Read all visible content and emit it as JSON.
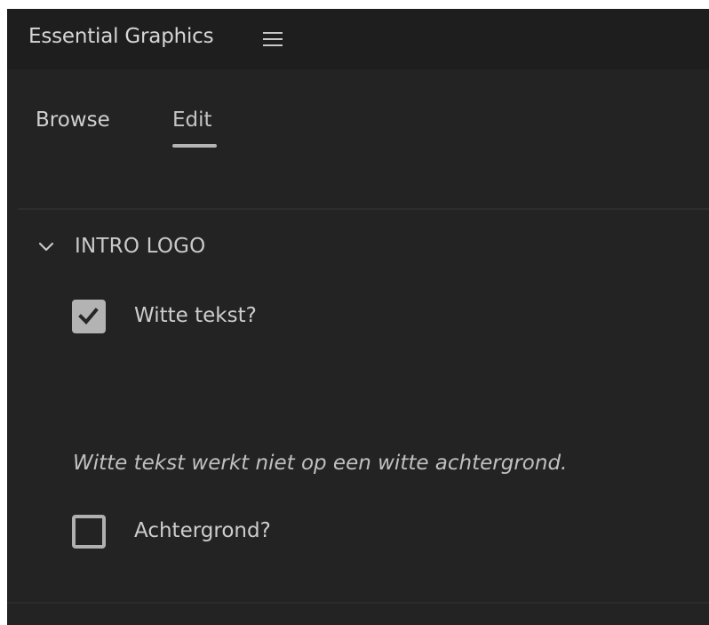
{
  "panel": {
    "title": "Essential Graphics",
    "menu_icon": "hamburger-menu-icon"
  },
  "tabs": [
    {
      "label": "Browse",
      "active": false
    },
    {
      "label": "Edit",
      "active": true
    }
  ],
  "section": {
    "title": "INTRO LOGO",
    "expanded": true,
    "toggle_icon": "chevron-down-icon"
  },
  "controls": {
    "witte_tekst": {
      "label": "Witte tekst?",
      "checked": true
    },
    "note": "Witte tekst werkt niet op een witte achtergrond.",
    "achtergrond": {
      "label": "Achtergrond?",
      "checked": false
    }
  },
  "colors": {
    "panel_background": "#232323",
    "header_background": "#1e1e1e",
    "text": "#cdcdcd",
    "checkbox": "#b3b3b3"
  }
}
